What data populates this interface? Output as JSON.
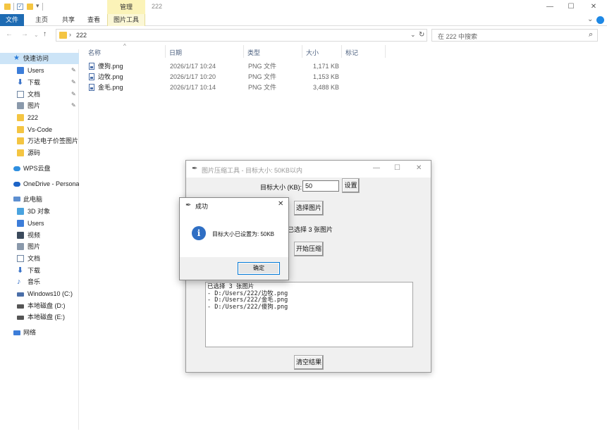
{
  "window": {
    "title": "222",
    "manage_tab": "管理",
    "controls": {
      "minimize": "—",
      "maximize": "☐",
      "close": "✕"
    }
  },
  "ribbon": {
    "tabs": [
      "文件",
      "主页",
      "共享",
      "查看",
      "图片工具"
    ],
    "expand": "⌄"
  },
  "nav": {
    "back": "←",
    "forward": "→",
    "recent": "⌄",
    "up": "↑",
    "address": "222",
    "address_sep": "›",
    "dropdown": "⌄",
    "refresh": "↻",
    "search_placeholder": "在 222 中搜索",
    "search_icon": "⌕"
  },
  "sidebar": {
    "items": [
      {
        "label": "快速访问",
        "icon": "star-icon",
        "pinned": false,
        "selected": true
      },
      {
        "label": "Users",
        "icon": "folder-blue-icon",
        "pinned": true
      },
      {
        "label": "下载",
        "icon": "download-icon",
        "pinned": true
      },
      {
        "label": "文档",
        "icon": "document-icon",
        "pinned": true
      },
      {
        "label": "图片",
        "icon": "pictures-icon",
        "pinned": true
      },
      {
        "label": "222",
        "icon": "folder-icon",
        "pinned": false
      },
      {
        "label": "Vs-Code",
        "icon": "folder-icon",
        "pinned": false
      },
      {
        "label": "万达电子价签图片",
        "icon": "folder-icon",
        "pinned": false
      },
      {
        "label": "源码",
        "icon": "folder-icon",
        "pinned": false
      },
      {
        "label": "WPS云盘",
        "icon": "cloud-icon",
        "pinned": false
      },
      {
        "label": "OneDrive - Persona",
        "icon": "onedrive-icon",
        "pinned": false
      },
      {
        "label": "此电脑",
        "icon": "computer-icon",
        "pinned": false
      },
      {
        "label": "3D 对象",
        "icon": "3d-objects-icon",
        "pinned": false
      },
      {
        "label": "Users",
        "icon": "folder-blue-icon",
        "pinned": false
      },
      {
        "label": "视频",
        "icon": "video-icon",
        "pinned": false
      },
      {
        "label": "图片",
        "icon": "pictures-icon",
        "pinned": false
      },
      {
        "label": "文档",
        "icon": "document-icon",
        "pinned": false
      },
      {
        "label": "下载",
        "icon": "download-icon",
        "pinned": false
      },
      {
        "label": "音乐",
        "icon": "music-icon",
        "pinned": false
      },
      {
        "label": "Windows10 (C:)",
        "icon": "drive-icon",
        "pinned": false
      },
      {
        "label": "本地磁盘 (D:)",
        "icon": "drive-icon",
        "pinned": false
      },
      {
        "label": "本地磁盘 (E:)",
        "icon": "drive-icon",
        "pinned": false
      },
      {
        "label": "网络",
        "icon": "network-icon",
        "pinned": false
      }
    ],
    "pin_glyph": "📌"
  },
  "filelist": {
    "columns": [
      "名称",
      "日期",
      "类型",
      "大小",
      "标记"
    ],
    "sort_indicator": "^",
    "rows": [
      {
        "name": "傻狗.png",
        "date": "2026/1/17 10:24",
        "type": "PNG 文件",
        "size": "1,171 KB"
      },
      {
        "name": "边牧.png",
        "date": "2026/1/17 10:20",
        "type": "PNG 文件",
        "size": "1,153 KB"
      },
      {
        "name": "金毛.png",
        "date": "2026/1/17 10:14",
        "type": "PNG 文件",
        "size": "3,488 KB"
      }
    ]
  },
  "compressor": {
    "title": "图片压缩工具 - 目标大小: 50KB以内",
    "controls": {
      "minimize": "—",
      "maximize": "☐",
      "close": "✕"
    },
    "target_label": "目标大小 (KB):",
    "target_value": "50",
    "set_button": "设置",
    "select_button": "选择图片",
    "selected_status": "已选择 3 张图片",
    "start_button": "开始压缩",
    "log_text": "已选择 3 张图片\n- D:/Users/222/边牧.png\n- D:/Users/222/金毛.png\n- D:/Users/222/傻狗.png",
    "clear_button": "清空结果"
  },
  "dialog": {
    "title": "成功",
    "close": "✕",
    "info_glyph": "i",
    "message": "目标大小已设置为: 50KB",
    "ok_button": "确定"
  },
  "colors": {
    "file_tab": "#1e6bb3",
    "manage_tab": "#fbf3b8",
    "selected_item": "#cce4f7",
    "info_icon": "#2f6fc4",
    "ok_border": "#0078d7"
  }
}
